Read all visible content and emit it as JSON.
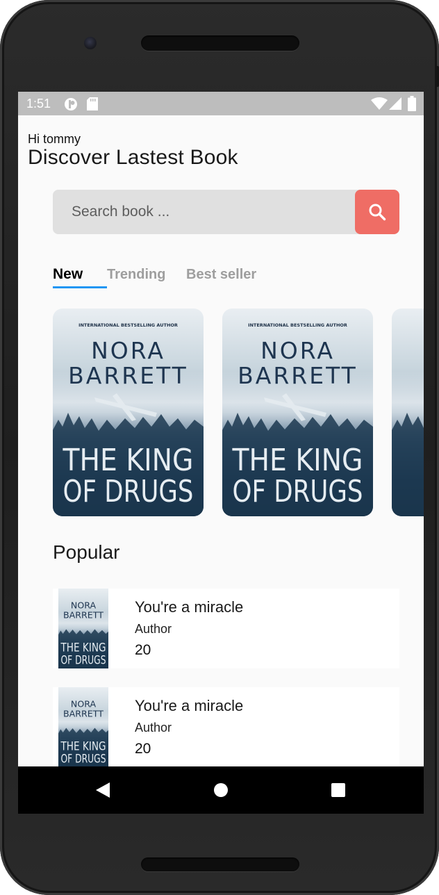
{
  "status_bar": {
    "time": "1:51"
  },
  "header": {
    "greeting": "Hi tommy",
    "title": "Discover Lastest Book"
  },
  "search": {
    "placeholder": "Search book ...",
    "button_icon": "search-icon"
  },
  "tabs": [
    {
      "label": "New",
      "active": true
    },
    {
      "label": "Trending",
      "active": false
    },
    {
      "label": "Best seller",
      "active": false
    }
  ],
  "cover_text": {
    "tagline": "INTERNATIONAL BESTSELLING AUTHOR",
    "author_first": "NORA",
    "author_last": "BARRETT",
    "title_line1": "THE KING",
    "title_line2": "OF DRUGS"
  },
  "popular": {
    "section_title": "Popular",
    "items": [
      {
        "title": "You're a miracle",
        "author": "Author",
        "price": "20"
      },
      {
        "title": "You're a miracle",
        "author": "Author",
        "price": "20"
      }
    ]
  },
  "colors": {
    "accent": "#ef6d65",
    "tab_indicator": "#2196f3",
    "search_bg": "#e0e0e0"
  }
}
